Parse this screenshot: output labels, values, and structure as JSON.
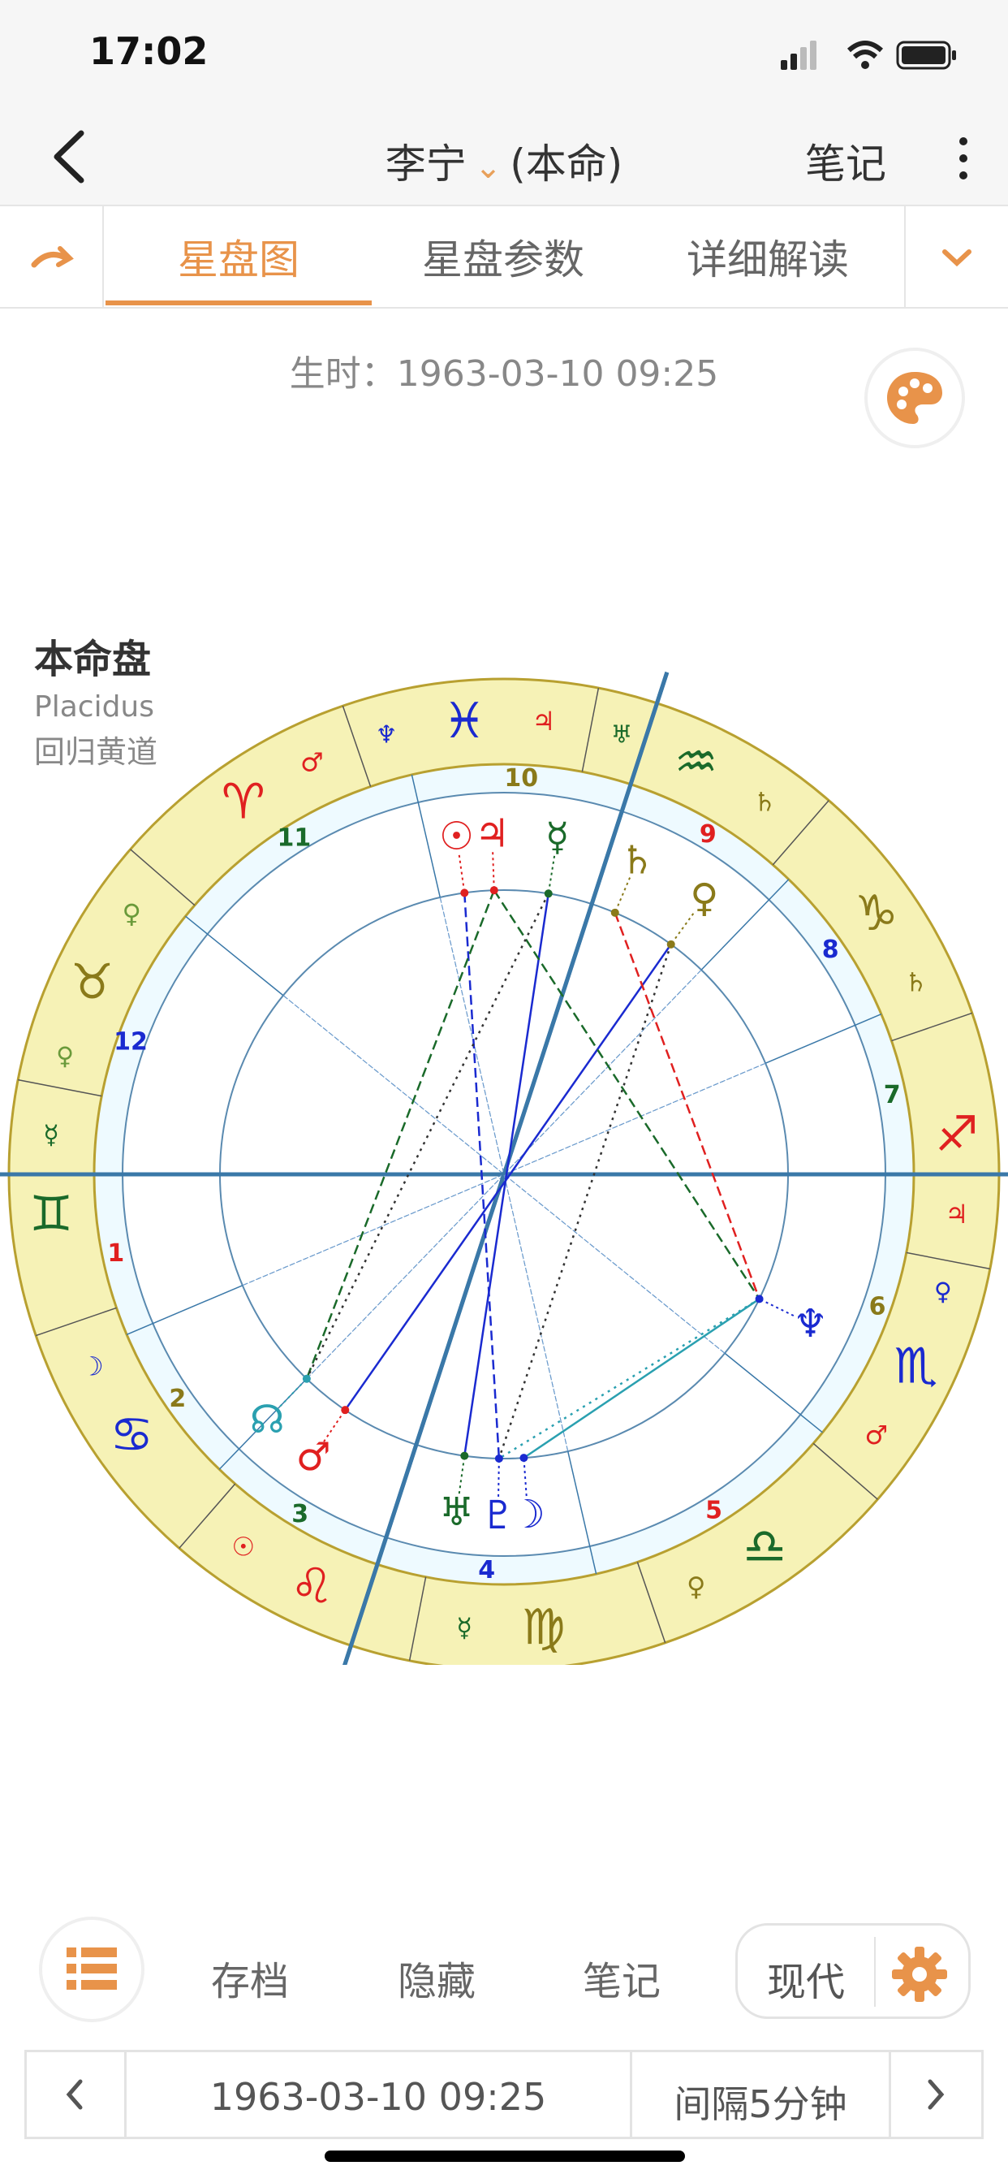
{
  "status_bar": {
    "time": "17:02"
  },
  "nav": {
    "person": "李宁",
    "chart_kind": "(本命)",
    "notes": "笔记"
  },
  "tabs": [
    {
      "label": "星盘图"
    },
    {
      "label": "星盘参数"
    },
    {
      "label": "详细解读"
    }
  ],
  "birth_time": "生时：1963-03-10 09:25",
  "chart_info": {
    "title": "本命盘",
    "house_system": "Placidus",
    "zodiac": "回归黄道"
  },
  "chart": {
    "asc_longitude": 71,
    "signs": [
      {
        "glyph": "♈︎",
        "color": "#e02020",
        "ruler": "♂",
        "ruler_color": "#e02020"
      },
      {
        "glyph": "♉︎",
        "color": "#8a7a1a",
        "ruler": "♀",
        "ruler_color": "#6a9a3a"
      },
      {
        "glyph": "♊︎",
        "color": "#1a6a2a",
        "ruler": "☿",
        "ruler_color": "#1a6a2a"
      },
      {
        "glyph": "♋︎",
        "color": "#1a2ad0",
        "ruler": "☽",
        "ruler_color": "#1a2ad0"
      },
      {
        "glyph": "♌︎",
        "color": "#e02020",
        "ruler": "☉",
        "ruler_color": "#e02020"
      },
      {
        "glyph": "♍︎",
        "color": "#8a7a1a",
        "ruler": "☿",
        "ruler_color": "#1a6a2a"
      },
      {
        "glyph": "♎︎",
        "color": "#1a6a2a",
        "ruler": "♀",
        "ruler_color": "#8a7a1a"
      },
      {
        "glyph": "♏︎",
        "color": "#1a2ad0",
        "ruler": "♂",
        "ruler_color": "#e02020"
      },
      {
        "glyph": "♐︎",
        "color": "#e02020",
        "ruler": "♃",
        "ruler_color": "#e02020"
      },
      {
        "glyph": "♑︎",
        "color": "#8a7a1a",
        "ruler": "♄",
        "ruler_color": "#8a7a1a"
      },
      {
        "glyph": "♒︎",
        "color": "#1a6a2a",
        "ruler": "♄",
        "ruler_color": "#8a7a1a"
      },
      {
        "glyph": "♓︎",
        "color": "#1a2ad0",
        "ruler": "♃",
        "ruler_color": "#e02020"
      }
    ],
    "sign_secondary": [
      {
        "sign_index": 1,
        "glyph": "♀"
      },
      {
        "sign_index": 7,
        "glyph": "♀",
        "color": "#1a2ad0"
      },
      {
        "sign_index": 10,
        "glyph": "♅",
        "color": "#1a6a2a"
      },
      {
        "sign_index": 11,
        "glyph": "♆",
        "color": "#1a2ad0"
      }
    ],
    "houses": [
      {
        "num": "1",
        "color": "#e02020"
      },
      {
        "num": "2",
        "color": "#8a7a1a"
      },
      {
        "num": "3",
        "color": "#1a6a2a"
      },
      {
        "num": "4",
        "color": "#1a2ad0"
      },
      {
        "num": "5",
        "color": "#e02020"
      },
      {
        "num": "6",
        "color": "#8a7a1a"
      },
      {
        "num": "7",
        "color": "#1a6a2a"
      },
      {
        "num": "8",
        "color": "#1a2ad0"
      },
      {
        "num": "9",
        "color": "#e02020"
      },
      {
        "num": "10",
        "color": "#8a7a1a"
      },
      {
        "num": "11",
        "color": "#1a6a2a"
      },
      {
        "num": "12",
        "color": "#1a2ad0"
      }
    ],
    "house_cusps": [
      71,
      94,
      117,
      143,
      174,
      212,
      251,
      274,
      297,
      323,
      354,
      32
    ],
    "planets": [
      {
        "glyph": "☉",
        "lon": 349,
        "color": "#e02020"
      },
      {
        "glyph": "♃",
        "lon": 343,
        "color": "#e02020"
      },
      {
        "glyph": "☿",
        "lon": 332,
        "color": "#1a6a2a"
      },
      {
        "glyph": "♄",
        "lon": 318,
        "color": "#8a7a1a"
      },
      {
        "glyph": "♀",
        "lon": 305,
        "color": "#8a7a1a"
      },
      {
        "glyph": "♆",
        "lon": 225,
        "color": "#1a2ad0"
      },
      {
        "glyph": "☽",
        "lon": 165,
        "color": "#1a2ad0"
      },
      {
        "glyph": "♇",
        "lon": 160,
        "color": "#1a2ad0"
      },
      {
        "glyph": "♅",
        "lon": 153,
        "color": "#1a6a2a"
      },
      {
        "glyph": "♂",
        "lon": 127,
        "color": "#e02020"
      },
      {
        "glyph": "☊",
        "lon": 117,
        "color": "#2aa0b0"
      }
    ],
    "aspects": [
      {
        "a": 4,
        "b": 9,
        "color": "#1a2ad0",
        "style": "solid"
      },
      {
        "a": 2,
        "b": 8,
        "color": "#1a2ad0",
        "style": "solid"
      },
      {
        "a": 3,
        "b": 5,
        "color": "#e02020",
        "style": "dash"
      },
      {
        "a": 1,
        "b": 5,
        "color": "#1a6a2a",
        "style": "dash"
      },
      {
        "a": 0,
        "b": 7,
        "color": "#1a2ad0",
        "style": "dash"
      },
      {
        "a": 5,
        "b": 6,
        "color": "#2aa0b0",
        "style": "solid"
      },
      {
        "a": 1,
        "b": 10,
        "color": "#1a6a2a",
        "style": "dash"
      },
      {
        "a": 2,
        "b": 10,
        "color": "#333333",
        "style": "dot"
      },
      {
        "a": 4,
        "b": 7,
        "color": "#333333",
        "style": "dot"
      },
      {
        "a": 5,
        "b": 7,
        "color": "#2aa0b0",
        "style": "dot"
      }
    ]
  },
  "bottom": {
    "archive": "存档",
    "hide": "隐藏",
    "notes": "笔记",
    "mode": "现代"
  },
  "date_bar": {
    "datetime": "1963-03-10 09:25",
    "interval": "间隔5分钟"
  },
  "colors": {
    "accent": "#e8934a",
    "ring": "#f6f2b6",
    "inner_ring": "#eefaff"
  }
}
